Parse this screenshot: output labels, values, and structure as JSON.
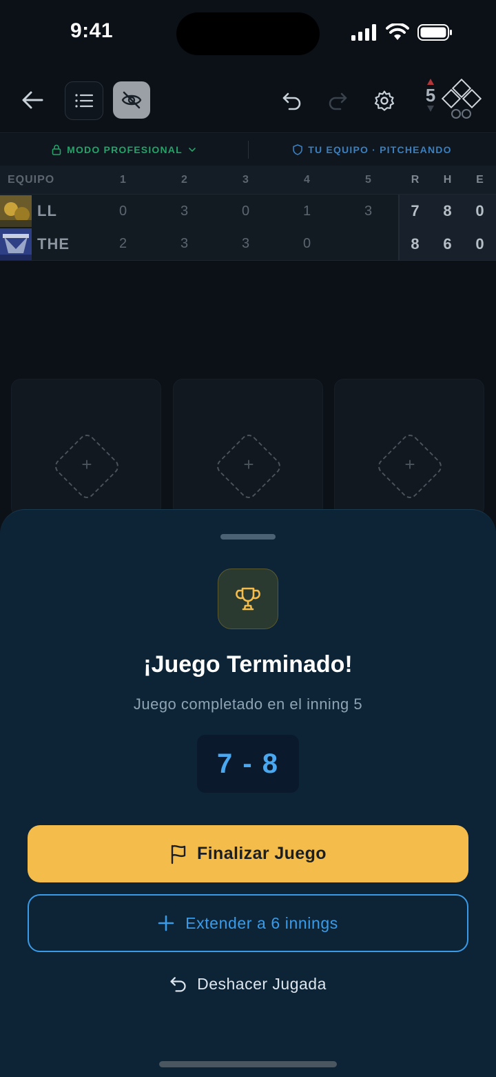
{
  "status_bar": {
    "time": "9:41"
  },
  "toolbar": {
    "inning": "5",
    "icons": [
      "back-arrow-icon",
      "list-icon",
      "eye-off-icon",
      "undo-icon",
      "redo-icon",
      "gear-icon",
      "bases-icon"
    ]
  },
  "mode": {
    "left": "MODO PROFESIONAL",
    "right": "TU EQUIPO · PITCHEANDO"
  },
  "scoreboard": {
    "header": {
      "team": "EQUIPO",
      "innings": [
        "1",
        "2",
        "3",
        "4",
        "5"
      ],
      "totals": [
        "R",
        "H",
        "E"
      ]
    },
    "teams": [
      {
        "name": "LL",
        "innings": [
          "0",
          "3",
          "0",
          "1",
          "3"
        ],
        "r": "7",
        "h": "8",
        "e": "0"
      },
      {
        "name": "THE",
        "innings": [
          "2",
          "3",
          "3",
          "0",
          ""
        ],
        "r": "8",
        "h": "6",
        "e": "0"
      }
    ]
  },
  "cards": [
    {
      "plus": "+"
    },
    {
      "plus": "+"
    },
    {
      "plus": "+"
    }
  ],
  "sheet": {
    "title": "¡Juego Terminado!",
    "subtitle": "Juego completado en el inning 5",
    "score": "7 - 8",
    "primary_button": "Finalizar Juego",
    "outline_button": "Extender a 6 innings",
    "text_button": "Deshacer Jugada",
    "colors": {
      "accent_yellow": "#f4bd4b",
      "accent_blue": "#3a9be8",
      "sheet_bg": "#0d2436"
    }
  }
}
